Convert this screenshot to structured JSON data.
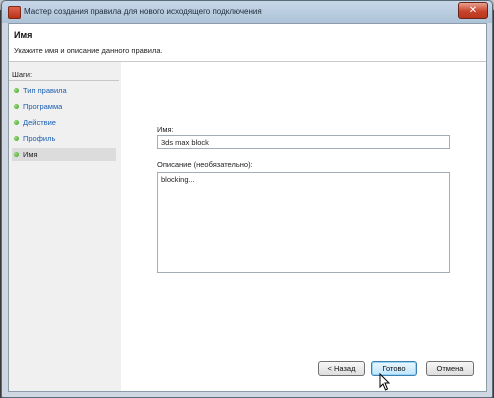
{
  "window": {
    "title": "Мастер создания правила для нового исходящего подключения",
    "close_symbol": "✕"
  },
  "header": {
    "title": "Имя",
    "description": "Укажите имя и описание данного правила."
  },
  "steps": {
    "title": "Шаги:",
    "items": [
      {
        "label": "Тип правила"
      },
      {
        "label": "Программа"
      },
      {
        "label": "Действие"
      },
      {
        "label": "Профиль"
      },
      {
        "label": "Имя"
      }
    ],
    "current_index": 4
  },
  "form": {
    "name_label": "Имя:",
    "name_value": "3ds max block",
    "description_label": "Описание (необязательно):",
    "description_value": "blocking..."
  },
  "buttons": {
    "back": "< Назад",
    "finish": "Готово",
    "cancel": "Отмена"
  },
  "colors": {
    "step_link": "#1a5fb4",
    "step_dot": "#3a9a2a",
    "accent_button": "#3c7fb1"
  }
}
